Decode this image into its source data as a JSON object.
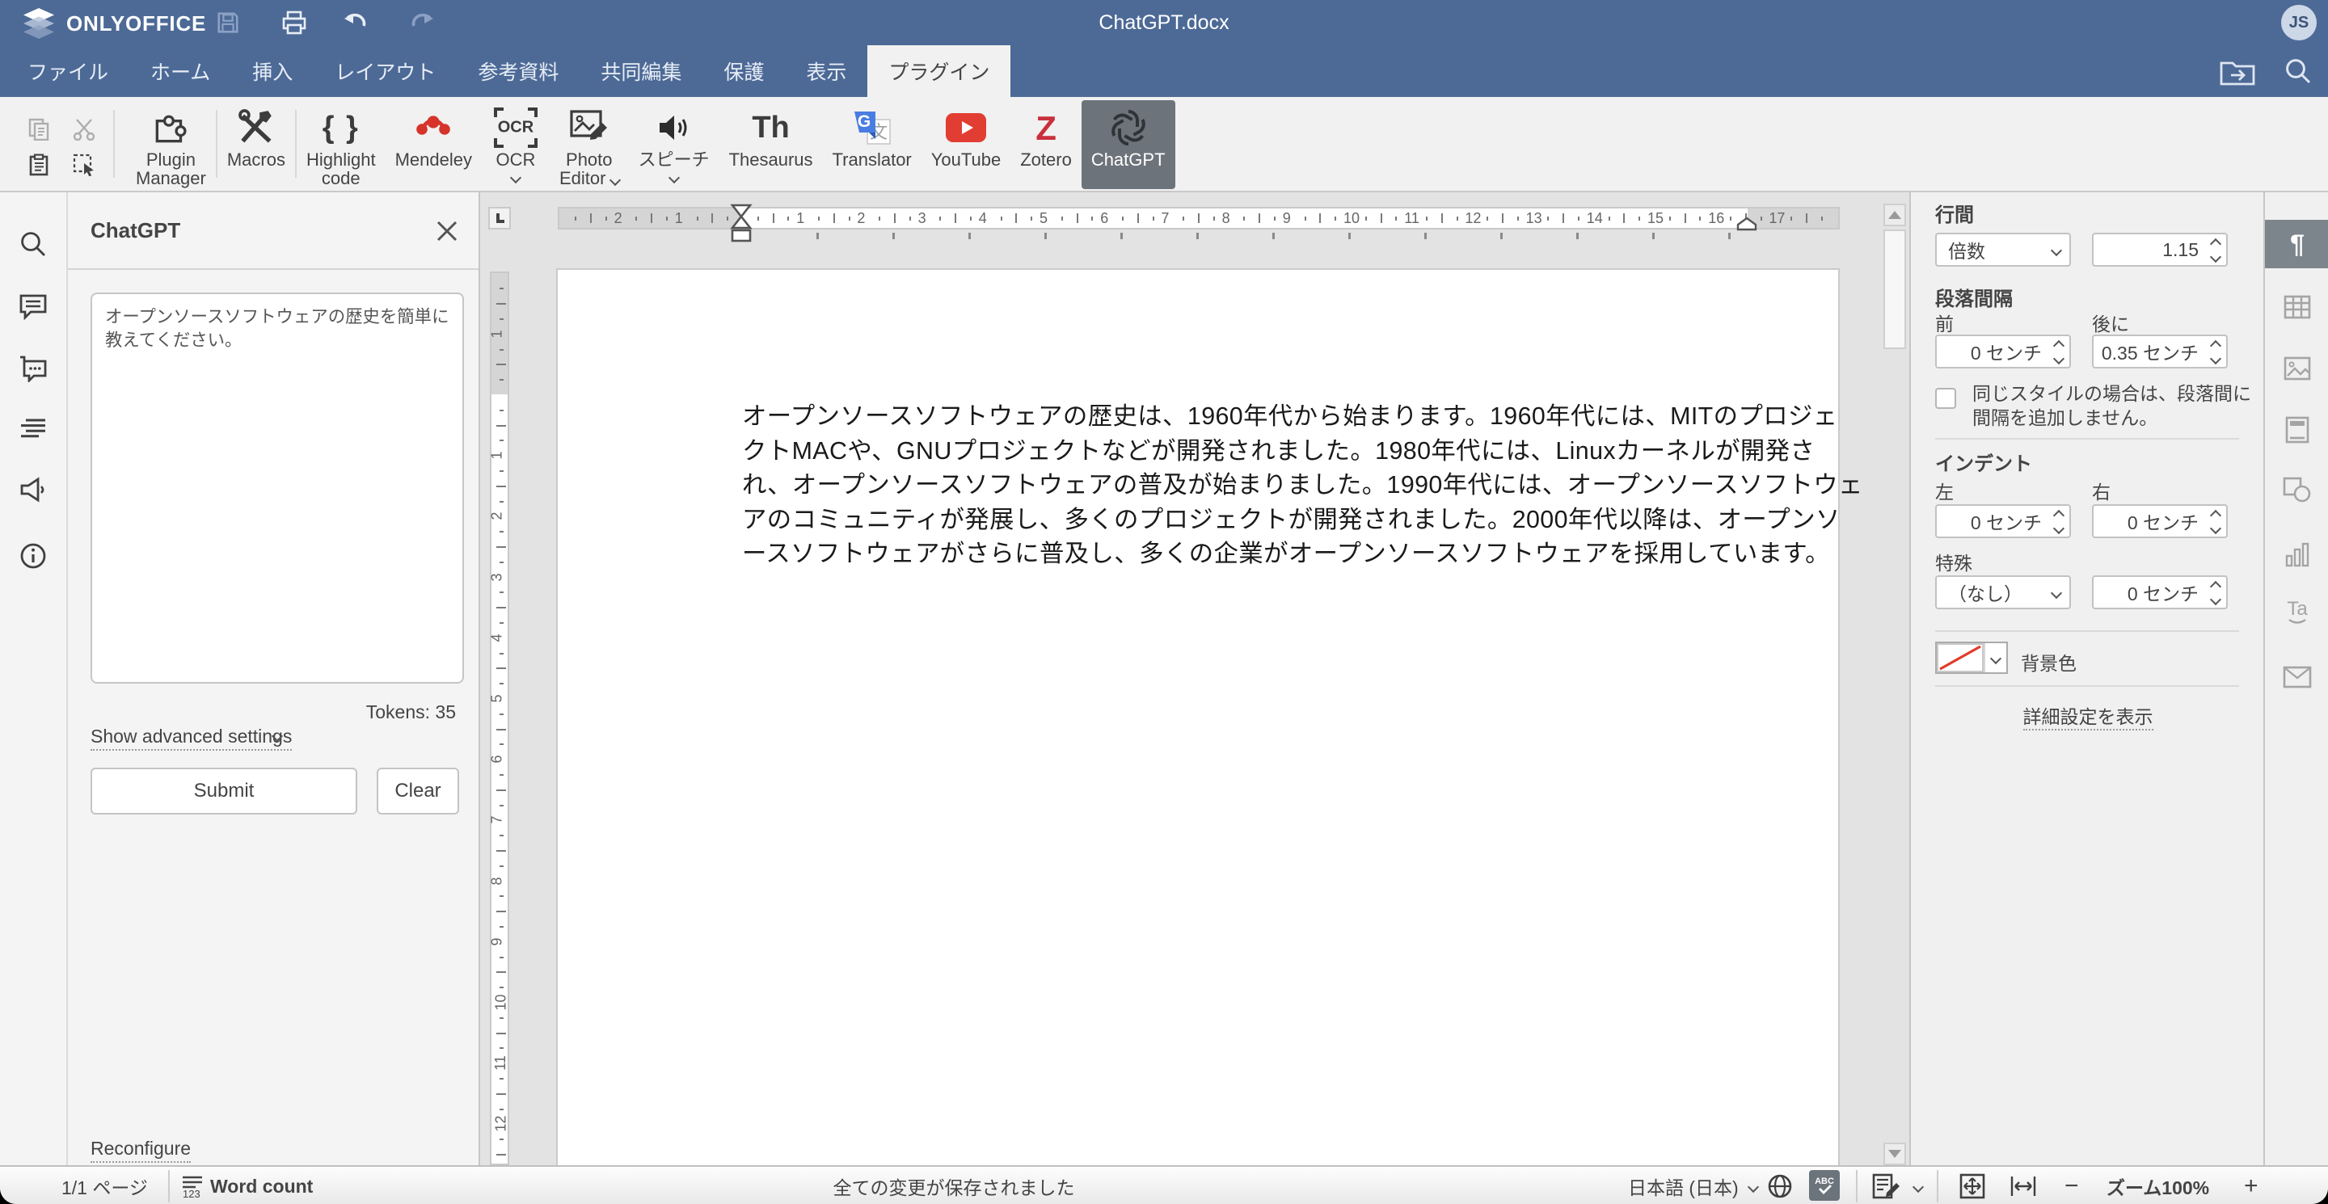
{
  "header": {
    "logo_text": "ONLYOFFICE",
    "title": "ChatGPT.docx",
    "avatar": "JS"
  },
  "tabs": [
    "ファイル",
    "ホーム",
    "挿入",
    "レイアウト",
    "参考資料",
    "共同編集",
    "保護",
    "表示",
    "プラグイン"
  ],
  "toolbar": {
    "plugins": [
      {
        "line1": "Plugin",
        "line2": "Manager"
      },
      {
        "line1": "Macros"
      },
      {
        "line1": "Highlight",
        "line2": "code"
      },
      {
        "line1": "Mendeley"
      },
      {
        "line1": "OCR"
      },
      {
        "line1": "Photo",
        "line2": "Editor"
      },
      {
        "line1": "スピーチ"
      },
      {
        "line1": "Thesaurus"
      },
      {
        "line1": "Translator"
      },
      {
        "line1": "YouTube"
      },
      {
        "line1": "Zotero"
      },
      {
        "line1": "ChatGPT"
      }
    ],
    "ocr_icon_text": "OCR"
  },
  "chat_panel": {
    "title": "ChatGPT",
    "prompt": "オープンソースソフトウェアの歴史を簡単に教えてください。",
    "tokens": "Tokens: 35",
    "advanced": "Show advanced settings",
    "submit": "Submit",
    "clear": "Clear",
    "reconfigure": "Reconfigure"
  },
  "document": {
    "lines": [
      "オープンソースソフトウェアの歴史は、1960年代から始まります。1960年代には、MITのプロジェ",
      "クトMACや、GNUプロジェクトなどが開発されました。1980年代には、Linuxカーネルが開発さ",
      "れ、オープンソースソフトウェアの普及が始まりました。1990年代には、オープンソースソフトウェ",
      "アのコミュニティが発展し、多くのプロジェクトが開発されました。2000年代以降は、オープンソ",
      "ースソフトウェアがさらに普及し、多くの企業がオープンソースソフトウェアを採用しています。"
    ]
  },
  "ruler": {
    "h_zero": 113,
    "h_cm": 37.6,
    "h_margin_right": 735,
    "h_len": 793,
    "v_zero": 75,
    "v_cm": 37.6,
    "v_len": 553,
    "tab_step": 47
  },
  "right_panel": {
    "line_spacing_label": "行間",
    "line_spacing_value": "倍数",
    "line_spacing_number": "1.15",
    "para_spacing_label": "段落間隔",
    "before_label": "前",
    "after_label": "後に",
    "before_value": "0 センチ",
    "after_value": "0.35 センチ",
    "same_style_text": "同じスタイルの場合は、段落間に間隔を追加しません。",
    "indent_label": "インデント",
    "left_label": "左",
    "right_label": "右",
    "left_value": "0 センチ",
    "right_value": "0 センチ",
    "special_label": "特殊",
    "special_value": "（なし）",
    "special_number": "0 センチ",
    "bg_label": "背景色",
    "advanced_link": "詳細設定を表示"
  },
  "status_bar": {
    "page": "1/1 ページ",
    "word_count": "Word count",
    "saved": "全ての変更が保存されました",
    "language": "日本語 (日本)",
    "zoom_label": "ズーム100%",
    "minus": "−",
    "plus": "+"
  }
}
